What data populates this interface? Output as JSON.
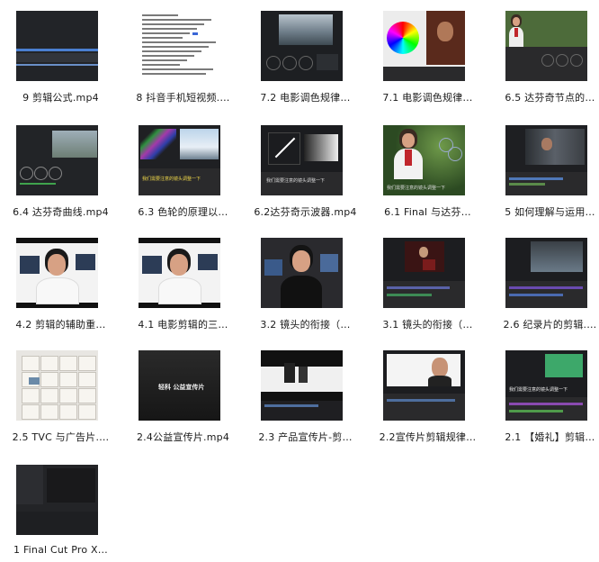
{
  "files": [
    {
      "label": "9 剪辑公式.mp4",
      "thumb": "timeline-blue"
    },
    {
      "label": "8 抖音手机短视频.…",
      "thumb": "text-doc"
    },
    {
      "label": "7.2 电影调色规律…",
      "thumb": "color-mountain"
    },
    {
      "label": "7.1 电影调色规律…",
      "thumb": "color-wheel"
    },
    {
      "label": "6.5 达芬奇节点的…",
      "thumb": "girl-scarf-small"
    },
    {
      "label": "6.4 达芬奇曲线.mp4",
      "thumb": "grading-sea"
    },
    {
      "label": "6.3 色轮的原理以…",
      "thumb": "scopes-sky"
    },
    {
      "label": "6.2达芬奇示波器.mp4",
      "thumb": "waveform-gradient"
    },
    {
      "label": "6.1 Final 与达芬…",
      "thumb": "girl-scarf-large"
    },
    {
      "label": "5 如何理解与运用…",
      "thumb": "film-grade"
    },
    {
      "label": "4.2 剪辑的辅助重…",
      "thumb": "man-room"
    },
    {
      "label": "4.1 电影剪辑的三…",
      "thumb": "man-room"
    },
    {
      "label": "3.2 镜头的衔接（…",
      "thumb": "man-dark"
    },
    {
      "label": "3.1 镜头的衔接（…",
      "thumb": "timeline-red"
    },
    {
      "label": "2.6 纪录片的剪辑.…",
      "thumb": "timeline-purple"
    },
    {
      "label": "2.5 TVC 与广告片.…",
      "thumb": "shelf"
    },
    {
      "label": "2.4公益宣传片.mp4",
      "thumb": "dark-title"
    },
    {
      "label": "2.3 产品宣传片-剪…",
      "thumb": "product"
    },
    {
      "label": "2.2宣传片剪辑规律…",
      "thumb": "bald-man"
    },
    {
      "label": "2.1 【婚礼】剪辑…",
      "thumb": "green-timeline"
    },
    {
      "label": "1 Final Cut Pro X…",
      "thumb": "empty-fcp"
    }
  ],
  "thumb_text": {
    "dark_title": "轻科 公益宣传片",
    "subtitle": "我们需要注意的镜头调整一下"
  }
}
